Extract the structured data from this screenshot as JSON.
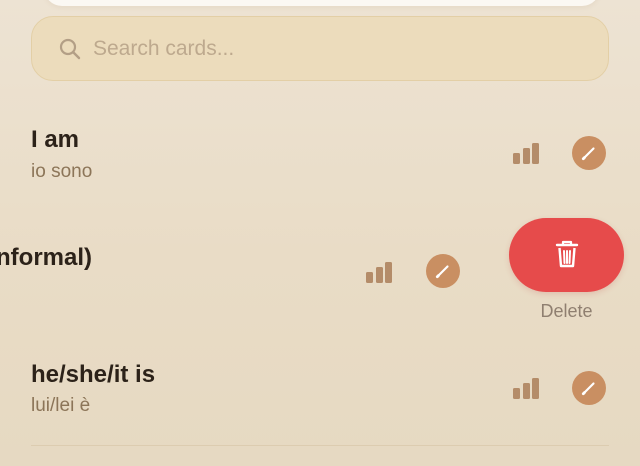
{
  "search": {
    "placeholder": "Search cards...",
    "value": ""
  },
  "cards": [
    {
      "term": "I am",
      "translation": "io sono",
      "level_icon": "signal-bars-icon",
      "edit_icon": "pencil-icon"
    },
    {
      "term": "nformal)",
      "level_icon": "signal-bars-icon",
      "edit_icon": "pencil-icon",
      "swipe_action": {
        "label": "Delete",
        "icon": "trash-icon"
      }
    },
    {
      "term": "he/she/it is",
      "translation": "lui/lei è",
      "level_icon": "signal-bars-icon",
      "edit_icon": "pencil-icon"
    }
  ],
  "colors": {
    "background": "#ebe0cd",
    "search_background": "#ecdcbc",
    "accent": "#c98f62",
    "level_bars": "#b48c69",
    "delete": "#e64b4b",
    "text_primary": "#2c2219",
    "text_secondary": "#8c7558"
  }
}
